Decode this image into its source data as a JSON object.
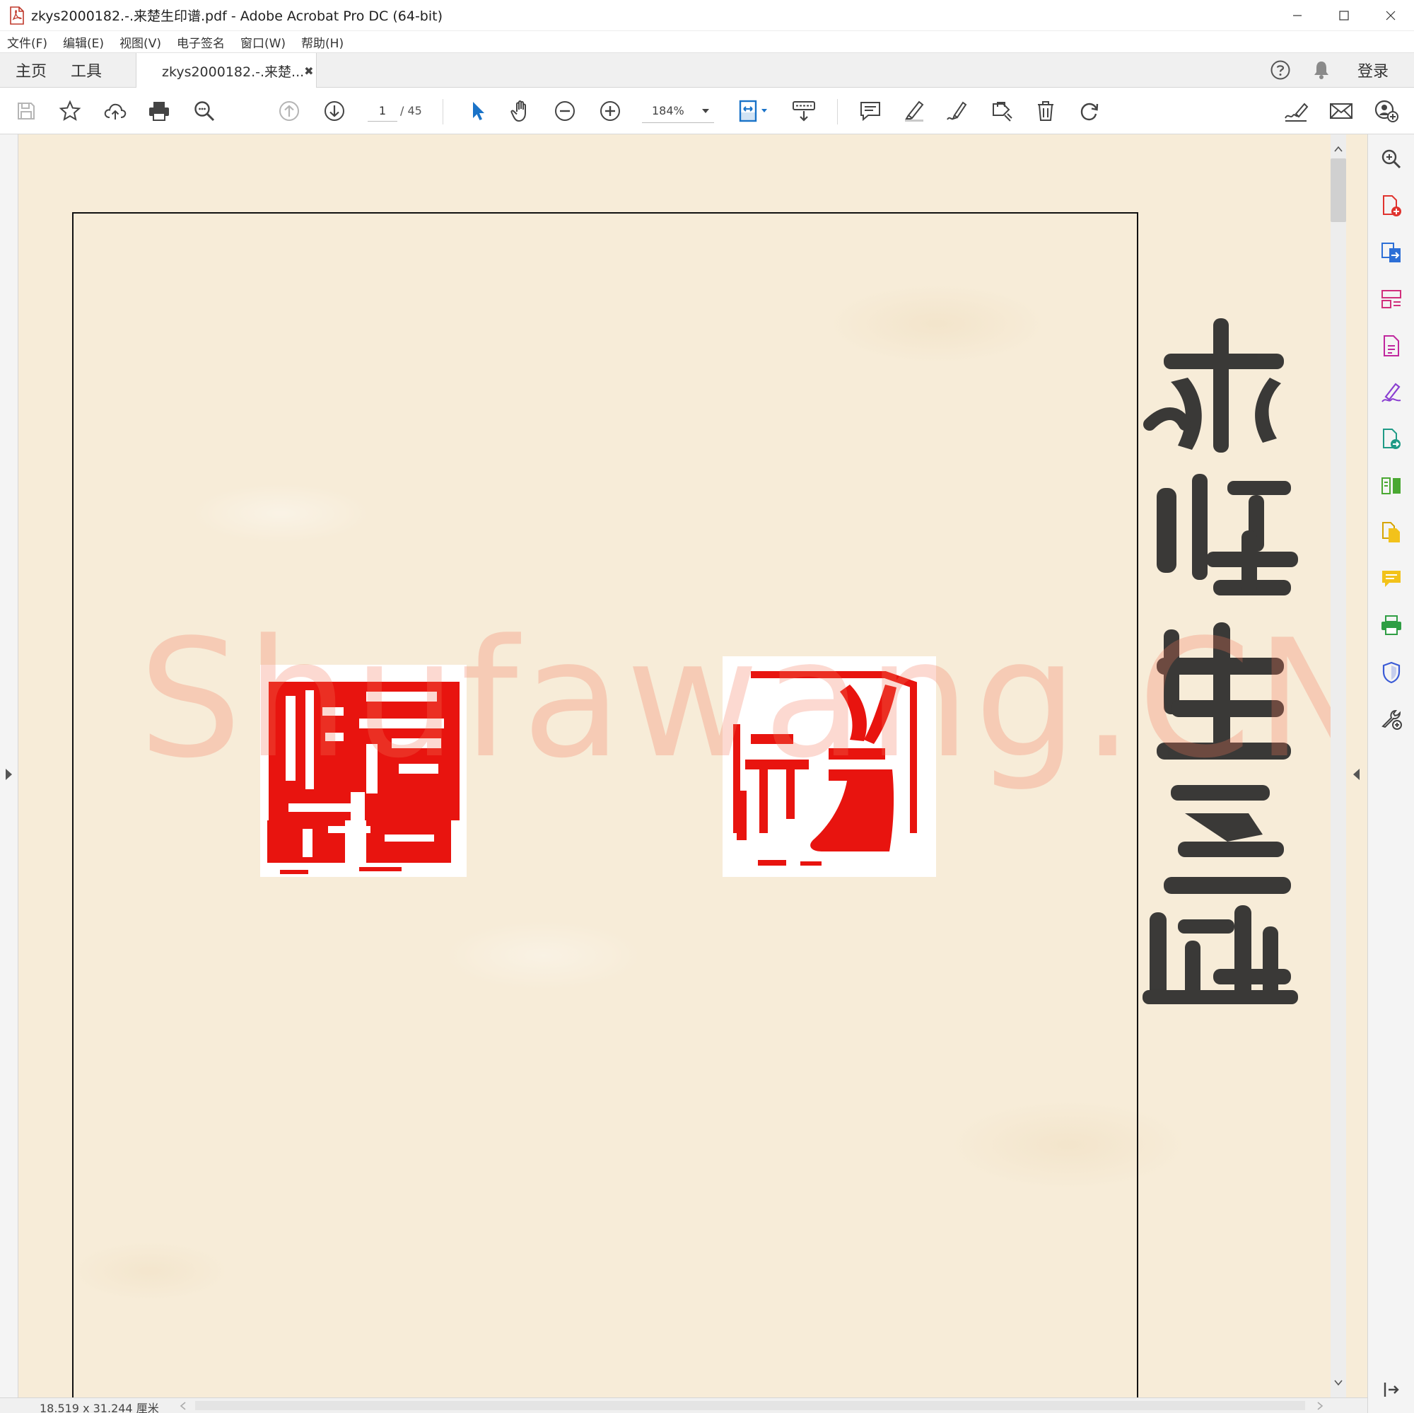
{
  "window": {
    "title": "zkys2000182.-.来楚生印谱.pdf - Adobe Acrobat Pro DC (64-bit)",
    "controls": [
      "minimize-icon",
      "maximize-icon",
      "close-icon"
    ]
  },
  "menu": {
    "items": [
      "文件(F)",
      "编辑(E)",
      "视图(V)",
      "电子签名",
      "窗口(W)",
      "帮助(H)"
    ]
  },
  "tabs": {
    "home": "主页",
    "tools": "工具",
    "document_tab": "zkys2000182.-.来楚...",
    "close_glyph": "✖",
    "login": "登录"
  },
  "toolbar": {
    "current_page": "1",
    "total_pages": "/ 45",
    "zoom": "184%"
  },
  "document": {
    "watermark": "Shufawang.CN"
  },
  "status": {
    "page_size": "18.519 x 31.244 厘米"
  },
  "colors": {
    "seal_red": "#e8140f",
    "paper": "#f7ecd8",
    "ink": "#222222",
    "accent_blue": "#1a73c8"
  },
  "right_pane_icons": [
    "zoom-search-icon",
    "create-pdf-icon",
    "export-pdf-icon",
    "organize-pages-icon",
    "edit-pdf-icon",
    "fill-sign-icon",
    "send-for-review-icon",
    "compare-files-icon",
    "combine-files-icon",
    "comment-icon",
    "print-production-icon",
    "protect-icon",
    "more-tools-icon",
    "collapse-pane-icon"
  ]
}
